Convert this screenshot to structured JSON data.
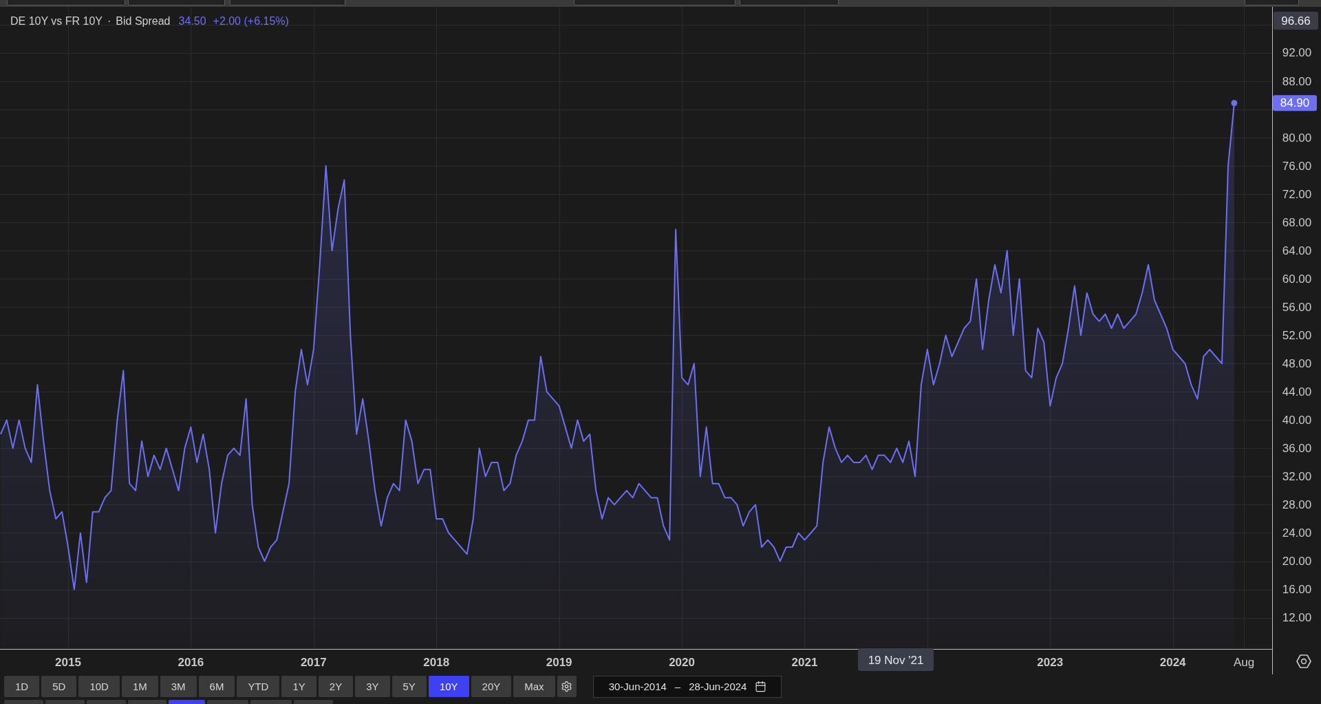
{
  "legend": {
    "separator": "·",
    "field": "Bid Spread",
    "value": "34.50",
    "change": "+2.00 (+6.15%)"
  },
  "crosshair": {
    "value": "96.66",
    "date": "19 Nov '21"
  },
  "last_value": "84.90",
  "chart_data": {
    "type": "area",
    "grid": true,
    "xlim": [
      2014.445,
      2024.809
    ],
    "ylim": [
      7.57,
      98.53
    ],
    "xticks": [
      2015,
      2016,
      2017,
      2018,
      2019,
      2020,
      2021,
      2023,
      2024,
      {
        "value": 2024.58,
        "label": "Aug"
      }
    ],
    "yticks": [
      {
        "value": 12,
        "label": "12.00"
      },
      {
        "value": 16,
        "label": "16.00"
      },
      {
        "value": 20,
        "label": "20.00"
      },
      {
        "value": 24,
        "label": "24.00"
      },
      {
        "value": 28,
        "label": "28.00"
      },
      {
        "value": 32,
        "label": "32.00"
      },
      {
        "value": 36,
        "label": "36.00"
      },
      {
        "value": 40,
        "label": "40.00"
      },
      {
        "value": 44,
        "label": "44.00"
      },
      {
        "value": 48,
        "label": "48.00"
      },
      {
        "value": 52,
        "label": "52.00"
      },
      {
        "value": 56,
        "label": "56.00"
      },
      {
        "value": 60,
        "label": "60.00"
      },
      {
        "value": 64,
        "label": "64.00"
      },
      {
        "value": 68,
        "label": "68.00"
      },
      {
        "value": 72,
        "label": "72.00"
      },
      {
        "value": 76,
        "label": "76.00"
      },
      {
        "value": 80,
        "label": "80.00"
      },
      {
        "value": 88,
        "label": "88.00"
      },
      {
        "value": 92,
        "label": "92.00"
      }
    ],
    "x": [
      2014.45,
      2014.5,
      2014.55,
      2014.6,
      2014.65,
      2014.7,
      2014.75,
      2014.8,
      2014.85,
      2014.9,
      2014.95,
      2015,
      2015.05,
      2015.1,
      2015.15,
      2015.2,
      2015.25,
      2015.3,
      2015.35,
      2015.4,
      2015.45,
      2015.5,
      2015.55,
      2015.6,
      2015.65,
      2015.7,
      2015.75,
      2015.8,
      2015.85,
      2015.9,
      2015.95,
      2016,
      2016.05,
      2016.1,
      2016.15,
      2016.2,
      2016.25,
      2016.3,
      2016.35,
      2016.4,
      2016.45,
      2016.5,
      2016.55,
      2016.6,
      2016.65,
      2016.7,
      2016.75,
      2016.8,
      2016.85,
      2016.9,
      2016.95,
      2017,
      2017.05,
      2017.1,
      2017.15,
      2017.2,
      2017.25,
      2017.3,
      2017.35,
      2017.4,
      2017.45,
      2017.5,
      2017.55,
      2017.6,
      2017.65,
      2017.7,
      2017.75,
      2017.8,
      2017.85,
      2017.9,
      2017.95,
      2018,
      2018.05,
      2018.1,
      2018.15,
      2018.2,
      2018.25,
      2018.3,
      2018.35,
      2018.4,
      2018.45,
      2018.5,
      2018.55,
      2018.6,
      2018.65,
      2018.7,
      2018.75,
      2018.8,
      2018.85,
      2018.9,
      2018.95,
      2019,
      2019.05,
      2019.1,
      2019.15,
      2019.2,
      2019.25,
      2019.3,
      2019.35,
      2019.4,
      2019.45,
      2019.5,
      2019.55,
      2019.6,
      2019.65,
      2019.7,
      2019.75,
      2019.8,
      2019.85,
      2019.9,
      2019.95,
      2020,
      2020.05,
      2020.1,
      2020.15,
      2020.2,
      2020.25,
      2020.3,
      2020.35,
      2020.4,
      2020.45,
      2020.5,
      2020.55,
      2020.6,
      2020.65,
      2020.7,
      2020.75,
      2020.8,
      2020.85,
      2020.9,
      2020.95,
      2021,
      2021.05,
      2021.1,
      2021.15,
      2021.2,
      2021.25,
      2021.3,
      2021.35,
      2021.4,
      2021.45,
      2021.5,
      2021.55,
      2021.6,
      2021.65,
      2021.7,
      2021.75,
      2021.8,
      2021.85,
      2021.9,
      2021.95,
      2022,
      2022.05,
      2022.1,
      2022.15,
      2022.2,
      2022.25,
      2022.3,
      2022.35,
      2022.4,
      2022.45,
      2022.5,
      2022.55,
      2022.6,
      2022.65,
      2022.7,
      2022.75,
      2022.8,
      2022.85,
      2022.9,
      2022.95,
      2023,
      2023.05,
      2023.1,
      2023.15,
      2023.2,
      2023.25,
      2023.3,
      2023.35,
      2023.4,
      2023.45,
      2023.5,
      2023.55,
      2023.6,
      2023.65,
      2023.7,
      2023.75,
      2023.8,
      2023.85,
      2023.9,
      2023.95,
      2024,
      2024.05,
      2024.1,
      2024.15,
      2024.2,
      2024.25,
      2024.3,
      2024.35,
      2024.4,
      2024.45,
      2024.5
    ],
    "series": [
      {
        "name": "DE 10Y vs FR 10Y",
        "color": "#6c6ff2",
        "values": [
          38,
          40,
          36,
          40,
          36,
          34,
          45,
          37,
          30,
          26,
          27,
          22,
          16,
          24,
          17,
          27,
          27,
          29,
          30,
          40,
          47,
          31,
          30,
          37,
          32,
          35,
          33,
          36,
          33,
          30,
          36,
          39,
          34,
          38,
          33,
          24,
          31,
          35,
          36,
          35,
          43,
          28,
          22,
          20,
          22,
          23,
          27,
          31,
          44,
          50,
          45,
          50,
          62,
          76,
          64,
          70,
          74,
          52,
          38,
          43,
          37,
          30,
          25,
          29,
          31,
          30,
          40,
          37,
          31,
          33,
          33,
          26,
          26,
          24,
          23,
          22,
          21,
          26,
          36,
          32,
          34,
          34,
          30,
          31,
          35,
          37,
          40,
          40,
          49,
          44,
          43,
          42,
          39,
          36,
          40,
          37,
          38,
          30,
          26,
          29,
          28,
          29,
          30,
          29,
          31,
          30,
          29,
          29,
          25,
          23,
          67,
          46,
          45,
          48,
          32,
          39,
          31,
          31,
          29,
          29,
          28,
          25,
          27,
          28,
          22,
          23,
          22,
          20,
          22,
          22,
          24,
          23,
          24,
          25,
          34,
          39,
          36,
          34,
          35,
          34,
          34,
          35,
          33,
          35,
          35,
          34,
          36,
          34,
          37,
          32,
          45,
          50,
          45,
          48,
          52,
          49,
          51,
          53,
          54,
          60,
          50,
          57,
          62,
          58,
          64,
          52,
          60,
          47,
          46,
          53,
          51,
          42,
          46,
          48,
          53,
          59,
          52,
          58,
          55,
          54,
          55,
          53,
          55,
          53,
          54,
          55,
          58,
          62,
          57,
          55,
          53,
          50,
          49,
          48,
          45,
          43,
          49,
          50,
          49,
          48,
          76,
          84.9
        ]
      }
    ]
  },
  "range_buttons": [
    {
      "label": "1D",
      "selected": false
    },
    {
      "label": "5D",
      "selected": false
    },
    {
      "label": "10D",
      "selected": false
    },
    {
      "label": "1M",
      "selected": false
    },
    {
      "label": "3M",
      "selected": false
    },
    {
      "label": "6M",
      "selected": false
    },
    {
      "label": "YTD",
      "selected": false
    },
    {
      "label": "1Y",
      "selected": false
    },
    {
      "label": "2Y",
      "selected": false
    },
    {
      "label": "3Y",
      "selected": false
    },
    {
      "label": "5Y",
      "selected": false
    },
    {
      "label": "10Y",
      "selected": true
    },
    {
      "label": "20Y",
      "selected": false
    },
    {
      "label": "Max",
      "selected": false
    }
  ],
  "date_range": {
    "start": "30-Jun-2014",
    "separator": "–",
    "end": "28-Jun-2024"
  },
  "bottom_tabs": [
    {
      "selected": false
    },
    {
      "selected": false
    },
    {
      "selected": false
    },
    {
      "selected": false
    },
    {
      "selected": true
    },
    {
      "selected": false
    },
    {
      "selected": false
    },
    {
      "selected": false
    }
  ]
}
